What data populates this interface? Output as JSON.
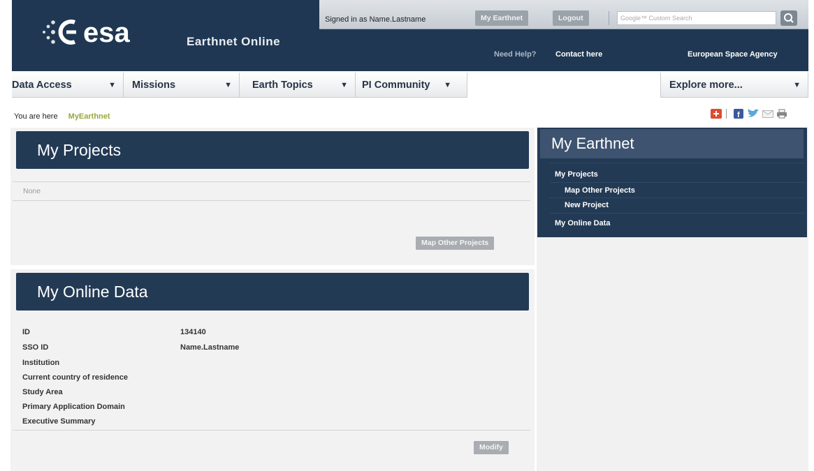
{
  "header": {
    "logo_text": "esa",
    "site_name": "Earthnet Online",
    "signed_in": "Signed in as Name.Lastname",
    "my_earthnet_button": "My Earthnet",
    "logout_button": "Logout",
    "search_placeholder": "Google™ Custom Search",
    "need_help": "Need Help?",
    "contact_link": "Contact here",
    "agency": "European Space Agency"
  },
  "nav": {
    "items": [
      {
        "label": "Data Access"
      },
      {
        "label": "Missions"
      },
      {
        "label": "Earth Topics"
      },
      {
        "label": "PI Community"
      }
    ],
    "explore": "Explore more..."
  },
  "breadcrumb": {
    "prefix": "You are here",
    "current": "MyEarthnet"
  },
  "share_icons": [
    "add-icon",
    "facebook-icon",
    "twitter-icon",
    "email-icon",
    "print-icon"
  ],
  "projects": {
    "title": "My Projects",
    "empty_text": "None",
    "map_button": "Map Other Projects"
  },
  "online_data": {
    "title": "My Online Data",
    "fields": [
      {
        "label": "ID",
        "value": "134140"
      },
      {
        "label": "SSO ID",
        "value": "Name.Lastname"
      },
      {
        "label": "Institution",
        "value": ""
      },
      {
        "label": "Current country of residence",
        "value": ""
      },
      {
        "label": "Study Area",
        "value": ""
      },
      {
        "label": "Primary Application Domain",
        "value": ""
      },
      {
        "label": "Executive Summary",
        "value": ""
      }
    ],
    "modify_button": "Modify"
  },
  "sidebar": {
    "title": "My Earthnet",
    "items": [
      {
        "label": "My Projects"
      },
      {
        "label": "Map Other Projects"
      },
      {
        "label": "New Project"
      },
      {
        "label": "My Online Data"
      }
    ]
  },
  "colors": {
    "header_bg": "#1f3752",
    "panel_head": "#233a55",
    "breadcrumb_accent": "#9aa63c",
    "button_grey": "#a9adb1"
  }
}
